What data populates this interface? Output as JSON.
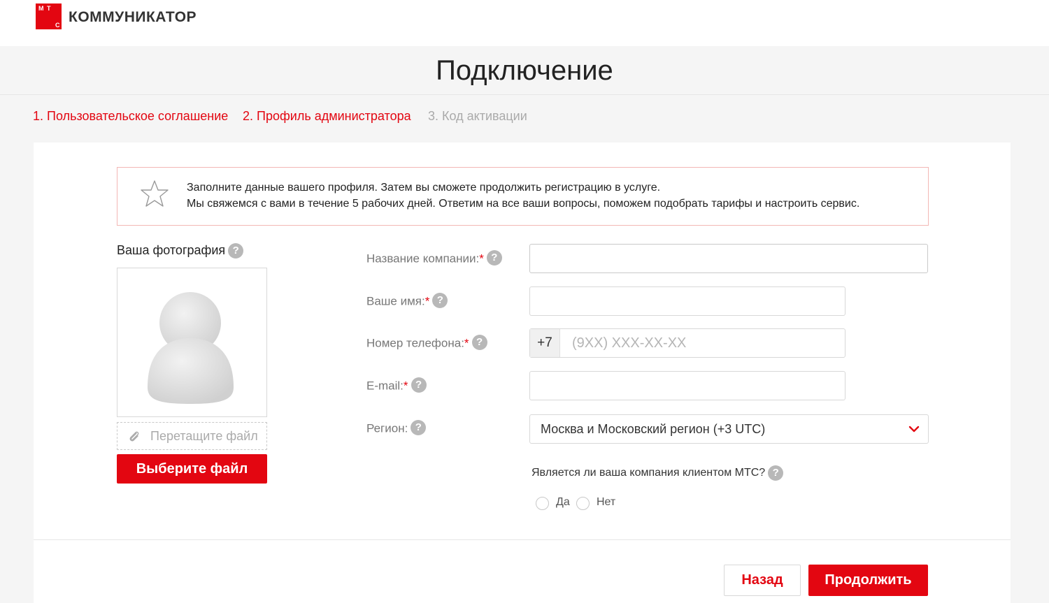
{
  "header": {
    "logo_letters": [
      "М",
      "Т",
      "С"
    ],
    "brand": "КОММУНИКАТОР"
  },
  "page": {
    "title": "Подключение"
  },
  "steps": [
    {
      "label": "1. Пользовательское соглашение",
      "state": "done"
    },
    {
      "label": "2. Профиль администратора",
      "state": "active"
    },
    {
      "label": "3. Код активации",
      "state": "pending"
    }
  ],
  "notice": {
    "line1": "Заполните данные вашего профиля. Затем вы сможете продолжить регистрацию в услуге.",
    "line2": "Мы свяжемся с вами в течение 5 рабочих дней. Ответим на все ваши вопросы, поможем подобрать тарифы и настроить сервис."
  },
  "photo": {
    "label": "Ваша фотография",
    "drop_text": "Перетащите файл",
    "choose_label": "Выберите файл"
  },
  "form": {
    "required_mark": "*",
    "help_glyph": "?",
    "company": {
      "label": "Название компании:",
      "value": ""
    },
    "name": {
      "label": "Ваше имя:",
      "value": ""
    },
    "phone": {
      "label": "Номер телефона:",
      "prefix": "+7",
      "placeholder": "(9XX) XXX-XX-XX"
    },
    "email": {
      "label": "E-mail:",
      "value": ""
    },
    "region": {
      "label": "Регион:",
      "value": "Москва и Московский регион (+3 UTC)"
    },
    "client_question": "Является ли ваша компания клиентом МТС?",
    "client_options": [
      "Да",
      "Нет"
    ]
  },
  "actions": {
    "back": "Назад",
    "next": "Продолжить"
  },
  "colors": {
    "accent": "#e30611",
    "muted": "#aaaaaa"
  }
}
